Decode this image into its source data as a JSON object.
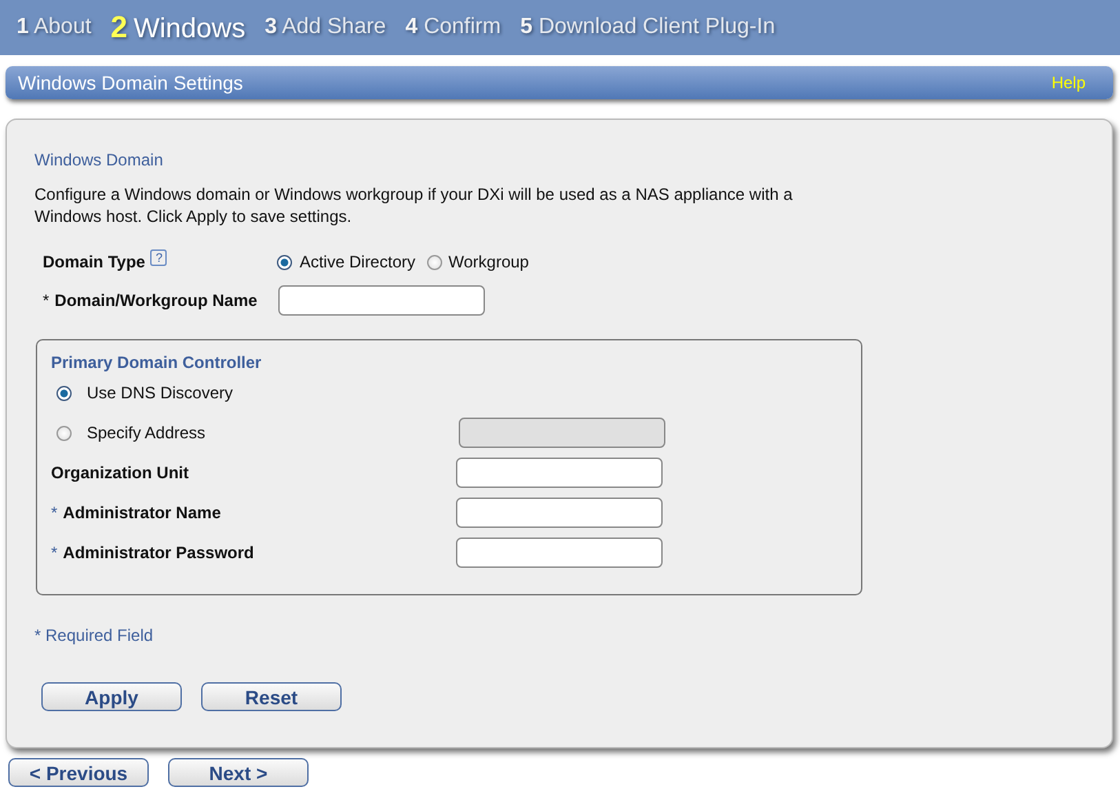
{
  "steps": [
    {
      "number": "1",
      "label": "About",
      "selected": false
    },
    {
      "number": "2",
      "label": "Windows",
      "selected": true
    },
    {
      "number": "3",
      "label": "Add Share",
      "selected": false
    },
    {
      "number": "4",
      "label": "Confirm",
      "selected": false
    },
    {
      "number": "5",
      "label": "Download Client Plug-In",
      "selected": false
    }
  ],
  "section_header": {
    "title": "Windows Domain Settings",
    "help": "Help"
  },
  "panel": {
    "title": "Windows Domain",
    "description": "Configure a Windows domain or Windows workgroup if your DXi will be used as a NAS appliance with a Windows host. Click Apply to save settings.",
    "domain_type": {
      "label": "Domain Type",
      "help_icon": "?",
      "options": [
        {
          "label": "Active Directory",
          "selected": true
        },
        {
          "label": "Workgroup",
          "selected": false
        }
      ]
    },
    "domain_name": {
      "marker": "*",
      "label": "Domain/Workgroup Name"
    },
    "controller": {
      "title": "Primary Domain Controller",
      "modes": [
        {
          "label": "Use DNS Discovery",
          "selected": true
        },
        {
          "label": "Specify Address",
          "selected": false,
          "address_field": {
            "disabled": true
          }
        }
      ],
      "fields": [
        {
          "label": "Organization Unit"
        },
        {
          "marker": "*",
          "label": "Administrator Name"
        },
        {
          "marker": "*",
          "label": "Administrator Password"
        }
      ]
    },
    "required_note": "* Required Field",
    "buttons": [
      "Apply",
      "Reset"
    ]
  },
  "nav_buttons": [
    "< Previous",
    "Next >"
  ]
}
